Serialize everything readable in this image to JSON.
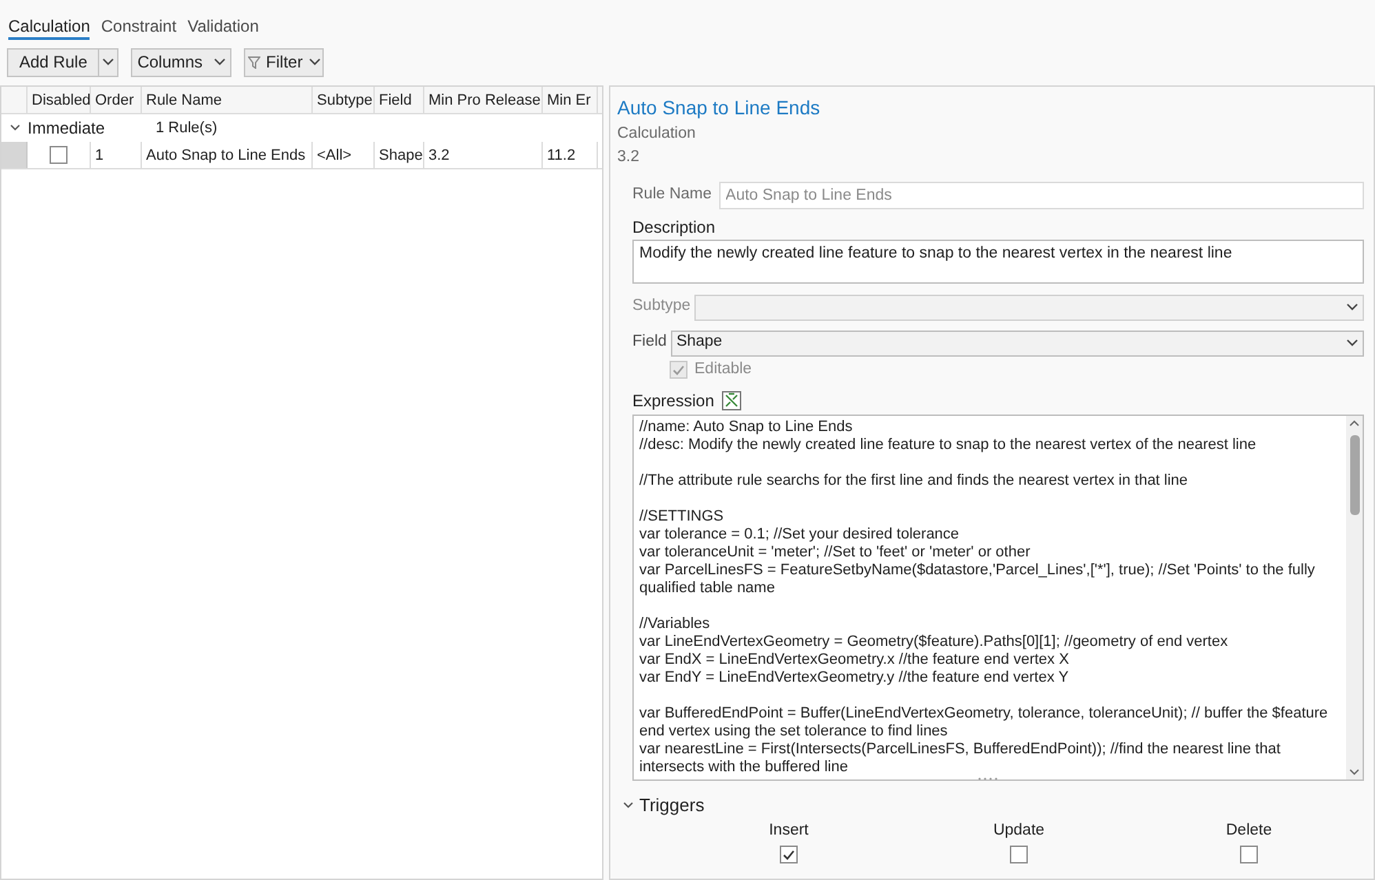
{
  "tabs": [
    {
      "label": "Calculation",
      "selected": true
    },
    {
      "label": "Constraint",
      "selected": false
    },
    {
      "label": "Validation",
      "selected": false
    }
  ],
  "toolbar": {
    "add_rule": "Add Rule",
    "columns": "Columns",
    "filter": "Filter"
  },
  "table": {
    "columns": [
      "Disabled",
      "Order",
      "Rule Name",
      "Subtype",
      "Field",
      "Min Pro Release",
      "Min Er"
    ],
    "groups": [
      {
        "label": "Immediate",
        "count": "1 Rule(s)",
        "expanded": true,
        "rows": [
          {
            "disabled": false,
            "order": "1",
            "rule_name": "Auto Snap to Line Ends",
            "subtype": "<All>",
            "field": "Shape",
            "min_pro_release": "3.2",
            "column_7": "11.2",
            "selected": false
          }
        ]
      }
    ]
  },
  "details": {
    "title": "Auto Snap to Line Ends",
    "type": "Calculation",
    "version": "3.2",
    "rule_name": {
      "label": "Rule Name",
      "value": "Auto Snap to Line Ends",
      "disabled": true
    },
    "description": {
      "label": "Description",
      "value": "Modify the newly created line feature to snap to the nearest vertex in the nearest line"
    },
    "subtype": {
      "label": "Subtype",
      "disabled": true
    },
    "field": {
      "label": "Field",
      "value": "Shape"
    },
    "editable": {
      "label": "Editable",
      "checked": true,
      "disabled": true
    },
    "expression": {
      "label": "Expression",
      "blocks": [
        [
          "//name: Auto Snap to Line Ends",
          "//desc: Modify the newly created line feature to snap to the nearest vertex of the nearest line"
        ],
        [
          "//The attribute rule searchs for the first line and finds the nearest vertex in that line"
        ],
        [
          "//SETTINGS",
          "var tolerance = 0.1; //Set your desired tolerance",
          "var toleranceUnit = 'meter'; //Set to 'feet' or 'meter' or other",
          "var ParcelLinesFS = FeatureSetbyName($datastore,'Parcel_Lines',['*'], true); //Set 'Points' to the fully qualified table name"
        ],
        [
          "//Variables",
          "var LineEndVertexGeometry = Geometry($feature).Paths[0][1]; //geometry of end vertex",
          "var EndX = LineEndVertexGeometry.x //the feature end vertex X",
          "var EndY = LineEndVertexGeometry.y //the feature end vertex Y"
        ],
        [
          "var BufferedEndPoint = Buffer(LineEndVertexGeometry, tolerance, toleranceUnit); // buffer the $feature end vertex using the set tolerance to find lines",
          "var nearestLine = First(Intersects(ParcelLinesFS, BufferedEndPoint)); //find the nearest line that intersects with the buffered line"
        ]
      ]
    },
    "triggers": {
      "label": "Triggers",
      "expanded": true,
      "items": [
        {
          "label": "Insert",
          "checked": true
        },
        {
          "label": "Update",
          "checked": false
        },
        {
          "label": "Delete",
          "checked": false
        }
      ]
    }
  }
}
